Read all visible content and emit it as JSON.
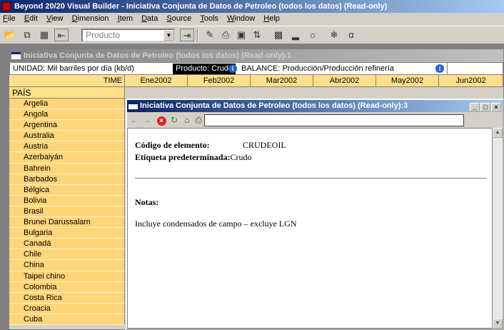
{
  "app": {
    "title": "Beyond 20/20 Visual Builder - Iniciativa Conjunta de Datos de Petroleo (todos los datos) (Read-only)"
  },
  "menu": [
    "File",
    "Edit",
    "View",
    "Dimension",
    "Item",
    "Data",
    "Source",
    "Tools",
    "Window",
    "Help"
  ],
  "toolbar": {
    "combo_value": "Producto"
  },
  "table_window": {
    "title": "Iniciativa Conjunta de Datos de Petroleo (todos los datos) (Read-only):1",
    "unit_label": "UNIDAD:  Mil barriles por día (kb/d)",
    "product_dim": "Producto: Crudo",
    "balance_dim": "BALANCE: Producción/Producción refinería",
    "time_label": "TIME",
    "row_dim_label": "PAÍS",
    "months": [
      "Ene2002",
      "Feb2002",
      "Mar2002",
      "Abr2002",
      "May2002",
      "Jun2002"
    ],
    "countries": [
      "Argelia",
      "Angola",
      "Argentina",
      "Australia",
      "Austria",
      "Azerbaiyán",
      "Bahrein",
      "Barbados",
      "Bélgica",
      "Bolivia",
      "Brasil",
      "Brunei Darussalam",
      "Bulgaria",
      "Canadá",
      "Chile",
      "China",
      "Taipei chino",
      "Colombia",
      "Costa Rica",
      "Croacia",
      "Cuba"
    ]
  },
  "info_window": {
    "title": "Iniciativa Conjunta de Datos de Petroleo (todos los datos) (Read-only):3",
    "code_label": "Código de elemento:",
    "code_value": "CRUDEOIL",
    "default_label": "Etiqueta predeterminada:",
    "default_value": "Crudo",
    "notes_label": "Notas:",
    "notes_text": "Incluye condensados de campo – excluye LGN"
  }
}
